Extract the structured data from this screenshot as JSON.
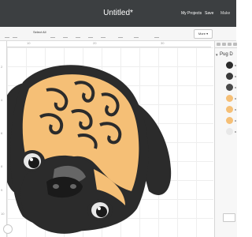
{
  "header": {
    "title": "Untitled*",
    "my_projects": "My Projects",
    "save": "Save",
    "make": "Make"
  },
  "toolbar": {
    "select_all": "Select All",
    "more": "More ▾"
  },
  "ruler": {
    "horizontal_ticks": [
      "10",
      "20",
      "30"
    ],
    "vertical_ticks": [
      "2",
      "4",
      "6",
      "8",
      "9",
      "10"
    ]
  },
  "layers": {
    "group_label": "Pug D"
  },
  "colors": {
    "header_bg": "#3c3f41",
    "pug_tan": "#f5bf76",
    "pug_dark": "#2b2b2b",
    "pug_gray": "#666666",
    "pug_light": "#e8e8e8"
  }
}
